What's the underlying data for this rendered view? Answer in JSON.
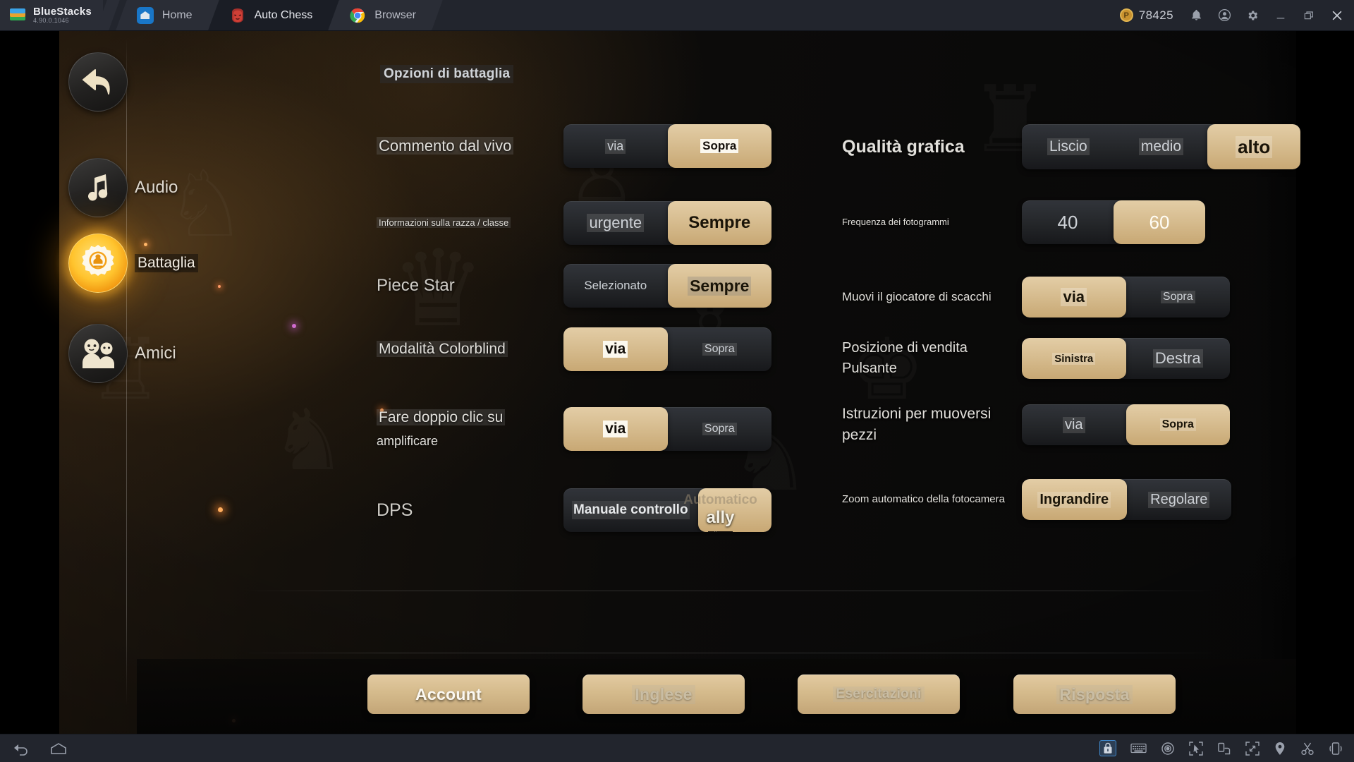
{
  "bluestacks": {
    "brand_name": "BlueStacks",
    "version": "4.90.0.1046",
    "tabs": [
      {
        "label": "Home",
        "icon": "home-icon",
        "active": false
      },
      {
        "label": "Auto Chess",
        "icon": "auto-chess-icon",
        "active": true
      },
      {
        "label": "Browser",
        "icon": "chrome-icon",
        "active": false
      }
    ],
    "coin_value": "78425",
    "coin_symbol": "P",
    "titlebar_icons": [
      "bell-icon",
      "account-icon",
      "gear-icon",
      "minimize-icon",
      "restore-icon",
      "close-icon"
    ],
    "bottombar_left_icons": [
      "back-icon",
      "home-icon"
    ],
    "bottombar_right_icons": [
      "lock-icon",
      "keyboard-icon",
      "eye-icon",
      "cursor-icon",
      "rotate-icon",
      "fullscreen-icon",
      "location-icon",
      "scissors-icon",
      "shake-icon"
    ]
  },
  "game": {
    "page_title": "Opzioni di battaglia",
    "nav": {
      "back_icon": "back-arrow-icon",
      "items": [
        {
          "label": "Audio",
          "icon": "music-note-icon",
          "active": false
        },
        {
          "label": "Battaglia",
          "icon": "gear-chess-icon",
          "active": true
        },
        {
          "label": "Amici",
          "icon": "friends-icon",
          "active": false
        }
      ]
    },
    "left_rows": [
      {
        "label": "Commento dal vivo",
        "label_lines": [
          "Commento dal vivo"
        ],
        "options": [
          "via",
          "Sopra"
        ],
        "selected": 1
      },
      {
        "label": "Informazioni sulla razza / classe",
        "label_lines": [
          "Informazioni sulla razza / classe"
        ],
        "options": [
          "urgente",
          "Sempre"
        ],
        "selected": 1
      },
      {
        "label": "Piece Star",
        "label_lines": [
          "Piece Star"
        ],
        "options": [
          "Selezionato",
          "Sempre"
        ],
        "selected": 1
      },
      {
        "label": "Modalità Colorblind",
        "label_lines": [
          "Modalità Colorblind"
        ],
        "options": [
          "via",
          "Sopra"
        ],
        "selected": 0
      },
      {
        "label": "Fare doppio clic su amplificare",
        "label_lines": [
          "Fare doppio clic su",
          "amplificare"
        ],
        "options": [
          "via",
          "Sopra"
        ],
        "selected": 0
      },
      {
        "label": "DPS",
        "label_lines": [
          "DPS"
        ],
        "options": [
          "Manuale controllo",
          "Automatico"
        ],
        "selected": 1
      }
    ],
    "dps_overlay": {
      "auto_text": "Automatico",
      "ally_text": "ally",
      "small_text": "alleato"
    },
    "right_rows": [
      {
        "label": "Qualità grafica",
        "label_lines": [
          "Qualità grafica"
        ],
        "options": [
          "Liscio",
          "medio",
          "alto"
        ],
        "selected": 2
      },
      {
        "label": "Frequenza dei fotogrammi",
        "label_lines": [
          "Frequenza dei fotogrammi"
        ],
        "options": [
          "40",
          "60"
        ],
        "selected": 1
      },
      {
        "label": "Muovi il giocatore di scacchi",
        "label_lines": [
          "Muovi il giocatore di scacchi"
        ],
        "options": [
          "via",
          "Sopra"
        ],
        "selected": 0
      },
      {
        "label": "Posizione di vendita Pulsante",
        "label_lines": [
          "Posizione di vendita",
          "Pulsante"
        ],
        "options": [
          "Sinistra",
          "Destra"
        ],
        "selected": 0
      },
      {
        "label": "Istruzioni per muoversi pezzi",
        "label_lines": [
          "Istruzioni per muoversi",
          " pezzi"
        ],
        "options": [
          "via",
          "Sopra"
        ],
        "selected": 1
      },
      {
        "label": "Zoom automatico della fotocamera",
        "label_lines": [
          "Zoom automatico della fotocamera"
        ],
        "options": [
          "Ingrandire",
          "Regolare"
        ],
        "selected": 0
      }
    ],
    "bottom_buttons": [
      {
        "label": "Account",
        "style": "primary"
      },
      {
        "label": "Inglese",
        "style": "dim"
      },
      {
        "label": "Esercitazioni",
        "style": "dim"
      },
      {
        "label": "Risposta",
        "style": "dim"
      }
    ]
  },
  "colors": {
    "selected_gold": "#d5bb8c",
    "panel_dark": "#141210",
    "chrome": "#22252d",
    "accent_glow": "#ffc42e"
  }
}
